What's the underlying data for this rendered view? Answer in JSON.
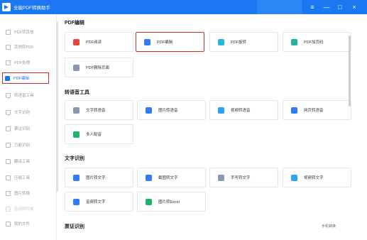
{
  "app": {
    "title": "全能PDF转换助手"
  },
  "window_controls": {
    "menu": "≡",
    "minimize": "—",
    "maximize": "□",
    "close": "×"
  },
  "sidebar": {
    "items": [
      {
        "label": "PDF转其他"
      },
      {
        "label": "其他转PDF"
      },
      {
        "label": "PDF处理"
      },
      {
        "label": "PDF编辑",
        "active": true
      },
      {
        "label": "转语音工具"
      },
      {
        "label": "文字识别"
      },
      {
        "label": "票证识别"
      },
      {
        "label": "万能识别"
      },
      {
        "label": "翻译工具"
      },
      {
        "label": "压缩工具"
      },
      {
        "label": "图片转换"
      },
      {
        "label": "音视频转换"
      },
      {
        "label": "我的文件"
      }
    ]
  },
  "sections": [
    {
      "title": "PDF编辑",
      "tools": [
        {
          "label": "PDF阅读",
          "icon": "pdf-read-icon",
          "color": "#e8453c"
        },
        {
          "label": "PDF编辑",
          "icon": "pdf-edit-icon",
          "color": "#2f7cf6",
          "selected": true
        },
        {
          "label": "PDF旋转",
          "icon": "pdf-rotate-icon",
          "color": "#29b6d6"
        },
        {
          "label": "PDF加页码",
          "icon": "pdf-page-number-icon",
          "color": "#1fb3a0"
        },
        {
          "label": "PDF删除页面",
          "icon": "pdf-delete-page-icon",
          "color": "#8a97ad"
        }
      ]
    },
    {
      "title": "转语音工具",
      "tools": [
        {
          "label": "文字转语音",
          "icon": "text-to-speech-icon",
          "color": "#8a97ad"
        },
        {
          "label": "图片转语音",
          "icon": "image-to-speech-icon",
          "color": "#2f7cf6"
        },
        {
          "label": "视频转语音",
          "icon": "video-to-speech-icon",
          "color": "#2da3f2"
        },
        {
          "label": "网页转语音",
          "icon": "webpage-to-speech-icon",
          "color": "#2f7cf6"
        },
        {
          "label": "多人配音",
          "icon": "multi-dubbing-icon",
          "color": "#1cb36b"
        }
      ]
    },
    {
      "title": "文字识别",
      "tools": [
        {
          "label": "图片转文字",
          "icon": "image-to-text-icon",
          "color": "#2f7cf6"
        },
        {
          "label": "截图转文字",
          "icon": "screenshot-to-text-icon",
          "color": "#2f7cf6"
        },
        {
          "label": "手写转文字",
          "icon": "handwriting-to-text-icon",
          "color": "#8a97ad"
        },
        {
          "label": "视频转文字",
          "icon": "video-to-text-icon",
          "color": "#2da3f2"
        },
        {
          "label": "音频转文字",
          "icon": "audio-to-text-icon",
          "color": "#2f7cf6"
        },
        {
          "label": "图片转Excel",
          "icon": "image-to-excel-icon",
          "color": "#1cb36b"
        }
      ]
    },
    {
      "title": "票证识别",
      "tools": []
    }
  ],
  "footer": {
    "link": "手机转换"
  }
}
